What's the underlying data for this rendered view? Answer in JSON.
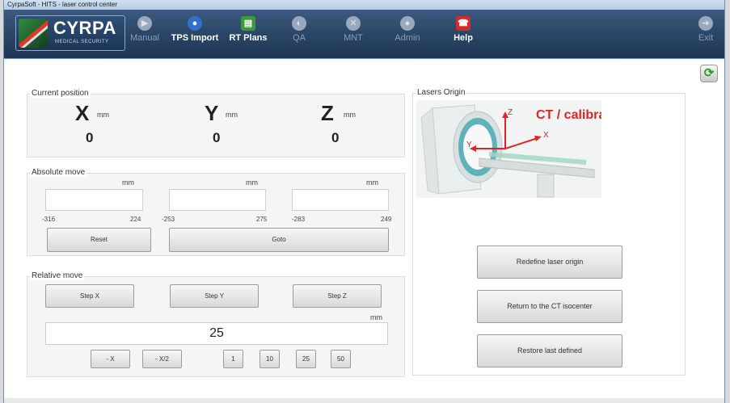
{
  "window": {
    "title": "CyrpaSoft - HITS - laser control center"
  },
  "logo": {
    "name": "CYRPA",
    "subtitle": "MEDICAL SECURITY"
  },
  "toolbar": {
    "manual": "Manual",
    "tps_import": "TPS Import",
    "rt_plans": "RT Plans",
    "qa": "QA",
    "mnt": "MNT",
    "admin": "Admin",
    "help": "Help",
    "exit": "Exit"
  },
  "current_position": {
    "title": "Current position",
    "x_label": "X",
    "y_label": "Y",
    "z_label": "Z",
    "unit": "mm",
    "x_value": "0",
    "y_value": "0",
    "z_value": "0"
  },
  "absolute_move": {
    "title": "Absolute move",
    "unit": "mm",
    "x": {
      "value": "",
      "min": "-316",
      "max": "224"
    },
    "y": {
      "value": "",
      "min": "-253",
      "max": "275"
    },
    "z": {
      "value": "",
      "min": "-283",
      "max": "249"
    },
    "reset_label": "Reset",
    "goto_label": "Goto"
  },
  "relative_move": {
    "title": "Relative move",
    "step_x": "Step X",
    "step_y": "Step Y",
    "step_z": "Step Z",
    "unit": "mm",
    "step_value": "25",
    "minus_x": "- X",
    "minus_x2": "- X/2",
    "presets": [
      "1",
      "10",
      "25",
      "50"
    ]
  },
  "lasers_origin": {
    "title": "Lasers Origin",
    "image_label": "CT / calibration",
    "axis_z": "Z",
    "axis_y": "Y",
    "axis_x": "X",
    "redefine_label": "Redefine laser origin",
    "return_label": "Return to the CT isocenter",
    "restore_label": "Restore last defined"
  },
  "colors": {
    "toolbar": "#2c4868",
    "panel_bg": "#f5f5f5",
    "ct_label": "#e02424",
    "refresh_icon": "#2e9a2e"
  }
}
